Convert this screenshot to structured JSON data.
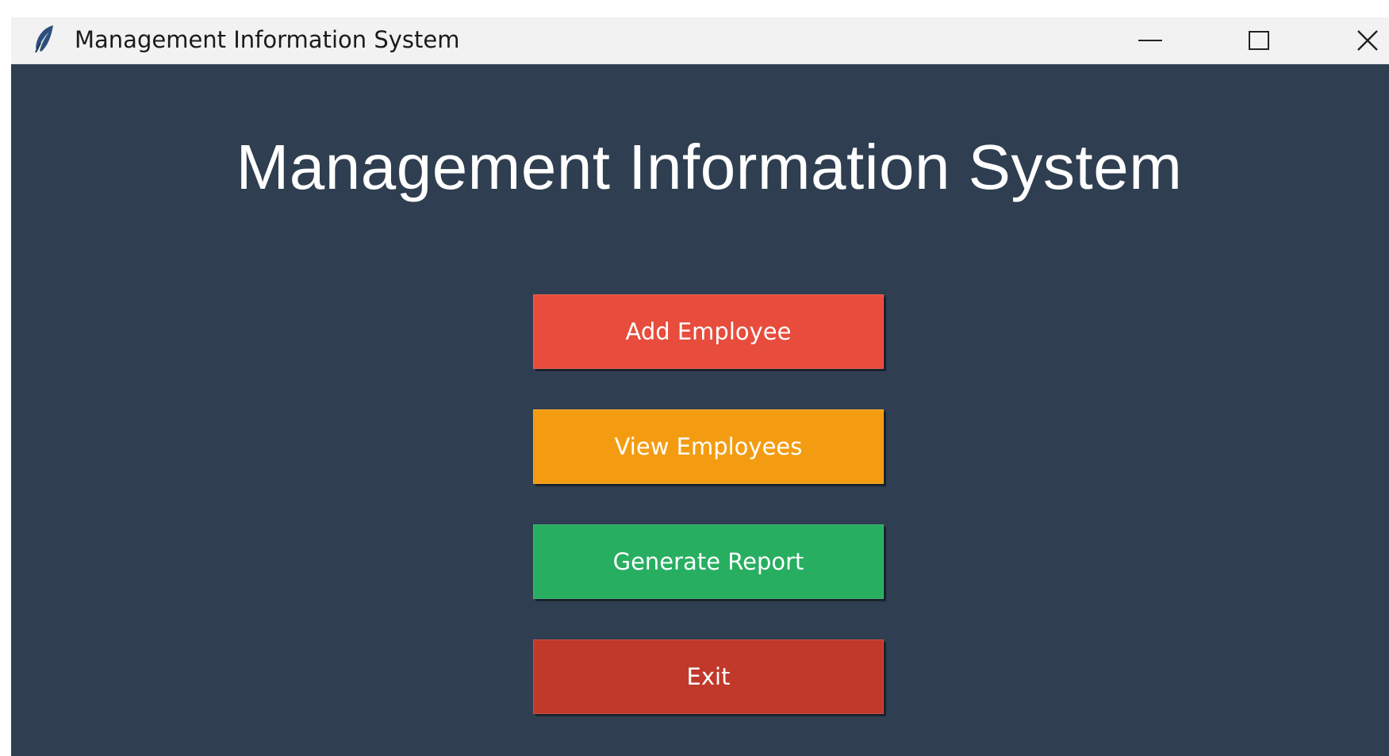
{
  "window": {
    "title": "Management Information System",
    "icon": "feather-icon",
    "controls": {
      "minimize": "minimize-icon",
      "maximize": "maximize-icon",
      "close": "close-icon"
    }
  },
  "main": {
    "heading": "Management Information System",
    "buttons": [
      {
        "label": "Add Employee",
        "color": "#e74c3c"
      },
      {
        "label": "View Employees",
        "color": "#f39c12"
      },
      {
        "label": "Generate Report",
        "color": "#27ae60"
      },
      {
        "label": "Exit",
        "color": "#c0392b"
      }
    ]
  },
  "colors": {
    "background": "#2f3e50",
    "titlebar": "#f2f2f2",
    "text": "#ffffff"
  }
}
